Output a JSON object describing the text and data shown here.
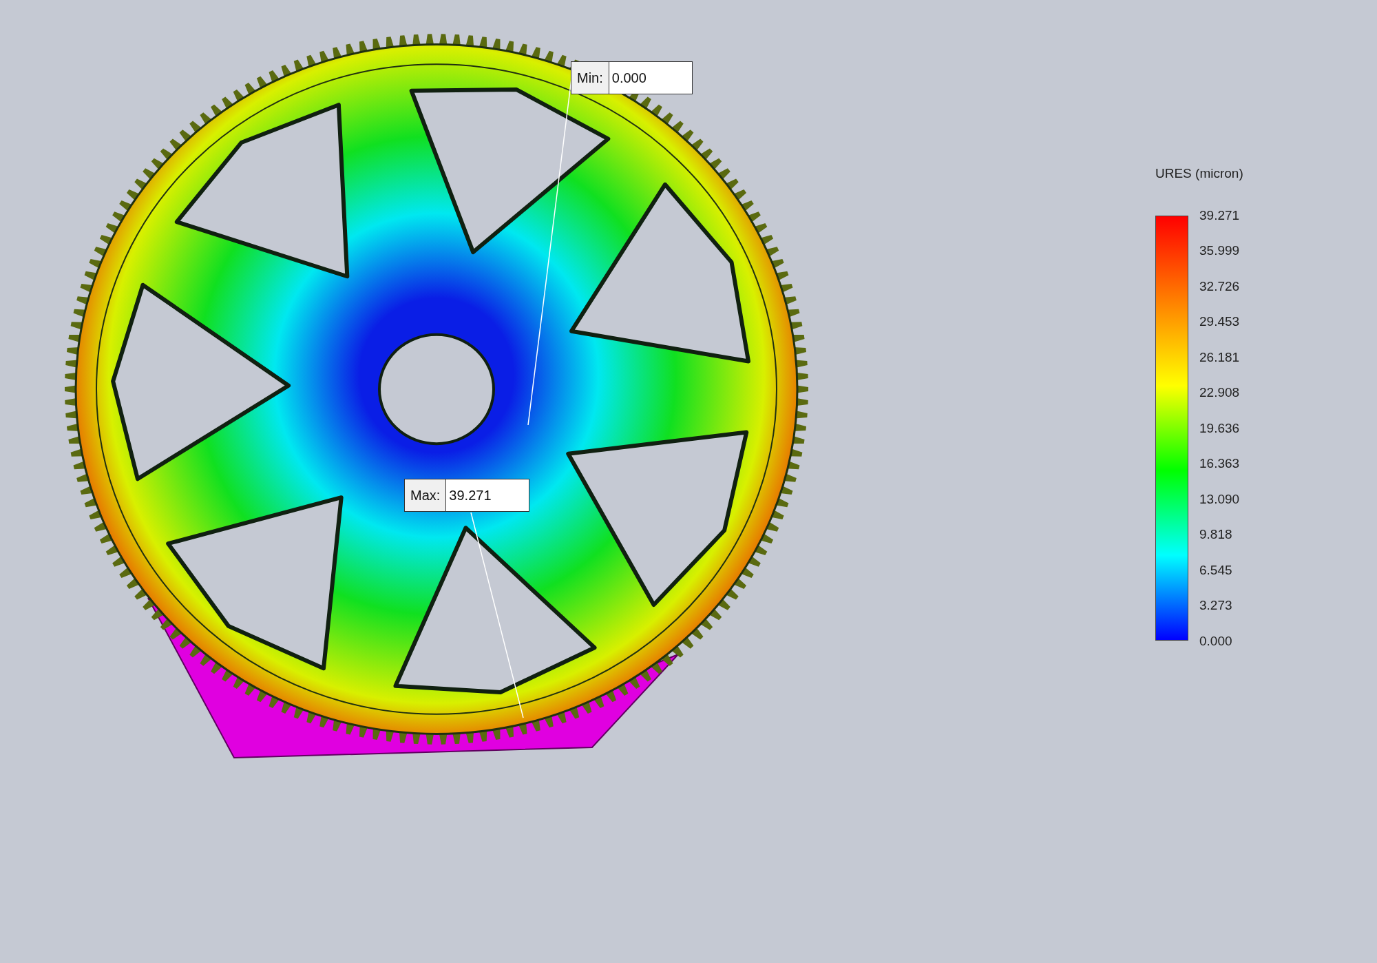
{
  "min_probe": {
    "label": "Min:",
    "value": "0.000"
  },
  "max_probe": {
    "label": "Max:",
    "value": "39.271"
  },
  "legend": {
    "title": "URES (micron)",
    "ticks": [
      "39.271",
      "35.999",
      "32.726",
      "29.453",
      "26.181",
      "22.908",
      "19.636",
      "16.363",
      "13.090",
      "9.818",
      "6.545",
      "3.273",
      "0.000"
    ]
  }
}
